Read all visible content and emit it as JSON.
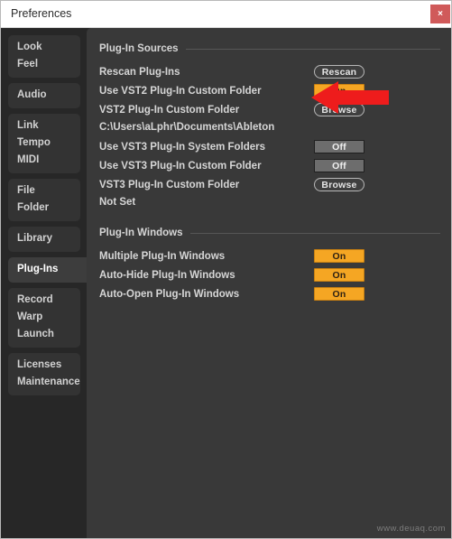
{
  "window": {
    "title": "Preferences",
    "close_label": "×",
    "background_color": "#272727",
    "panel_color": "#393939",
    "accent_color": "#f5a623",
    "annotation_color": "#ee1c1c"
  },
  "sidebar": {
    "groups": [
      {
        "selected": false,
        "items": [
          "Look",
          "Feel"
        ]
      },
      {
        "selected": false,
        "items": [
          "Audio"
        ]
      },
      {
        "selected": false,
        "items": [
          "Link",
          "Tempo",
          "MIDI"
        ]
      },
      {
        "selected": false,
        "items": [
          "File",
          "Folder"
        ]
      },
      {
        "selected": false,
        "items": [
          "Library"
        ]
      },
      {
        "selected": true,
        "items": [
          "Plug-Ins"
        ]
      },
      {
        "selected": false,
        "items": [
          "Record",
          "Warp",
          "Launch"
        ]
      },
      {
        "selected": false,
        "items": [
          "Licenses",
          "Maintenance"
        ]
      }
    ]
  },
  "sections": [
    {
      "title": "Plug-In Sources",
      "rows": [
        {
          "label": "Rescan Plug-Ins",
          "control": "Rescan",
          "type": "pill"
        },
        {
          "label": "Use VST2 Plug-In Custom Folder",
          "control": "On",
          "type": "toggle-on"
        },
        {
          "label": "VST2 Plug-In Custom Folder",
          "control": "Browse",
          "type": "pill"
        },
        {
          "label": "C:\\Users\\aLphr\\Documents\\Ableton",
          "control": null,
          "type": "path"
        },
        {
          "label": "Use VST3 Plug-In System Folders",
          "control": "Off",
          "type": "toggle-off"
        },
        {
          "label": "Use VST3 Plug-In Custom Folder",
          "control": "Off",
          "type": "toggle-off"
        },
        {
          "label": "VST3 Plug-In Custom Folder",
          "control": "Browse",
          "type": "pill"
        },
        {
          "label": "Not Set",
          "control": null,
          "type": "path"
        }
      ]
    },
    {
      "title": "Plug-In Windows",
      "rows": [
        {
          "label": "Multiple Plug-In Windows",
          "control": "On",
          "type": "toggle-on"
        },
        {
          "label": "Auto-Hide Plug-In Windows",
          "control": "On",
          "type": "toggle-on"
        },
        {
          "label": "Auto-Open Plug-In Windows",
          "control": "On",
          "type": "toggle-on"
        }
      ]
    }
  ],
  "annotation": {
    "shape": "left-arrow",
    "points_at": "Rescan"
  },
  "watermark": "www.deuaq.com"
}
